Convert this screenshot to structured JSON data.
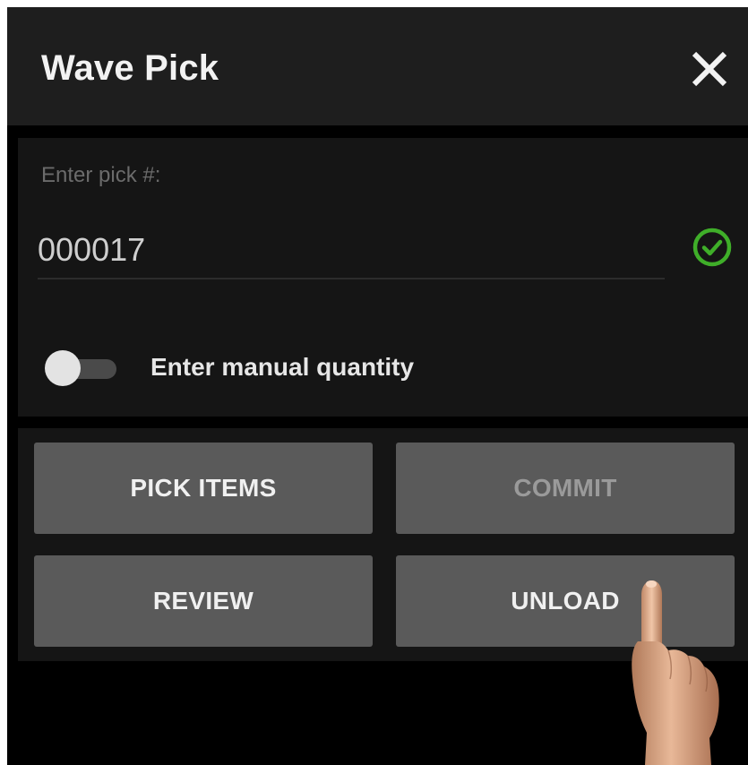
{
  "header": {
    "title": "Wave Pick",
    "close_icon": "close-icon"
  },
  "pick_form": {
    "label": "Enter pick #:",
    "value": "000017",
    "valid_icon": "check-circle-icon",
    "valid_color": "#3fae29"
  },
  "manual_quantity": {
    "label": "Enter manual quantity",
    "enabled": false
  },
  "actions": {
    "pick_items": "PICK ITEMS",
    "commit": "COMMIT",
    "review": "REVIEW",
    "unload": "UNLOAD"
  },
  "colors": {
    "header_bg": "#1e1e1e",
    "panel_bg": "#151515",
    "button_bg": "#5a5a5a",
    "disabled_text": "#9a9a9a"
  },
  "overlay": {
    "icon": "pointing-hand-icon"
  }
}
